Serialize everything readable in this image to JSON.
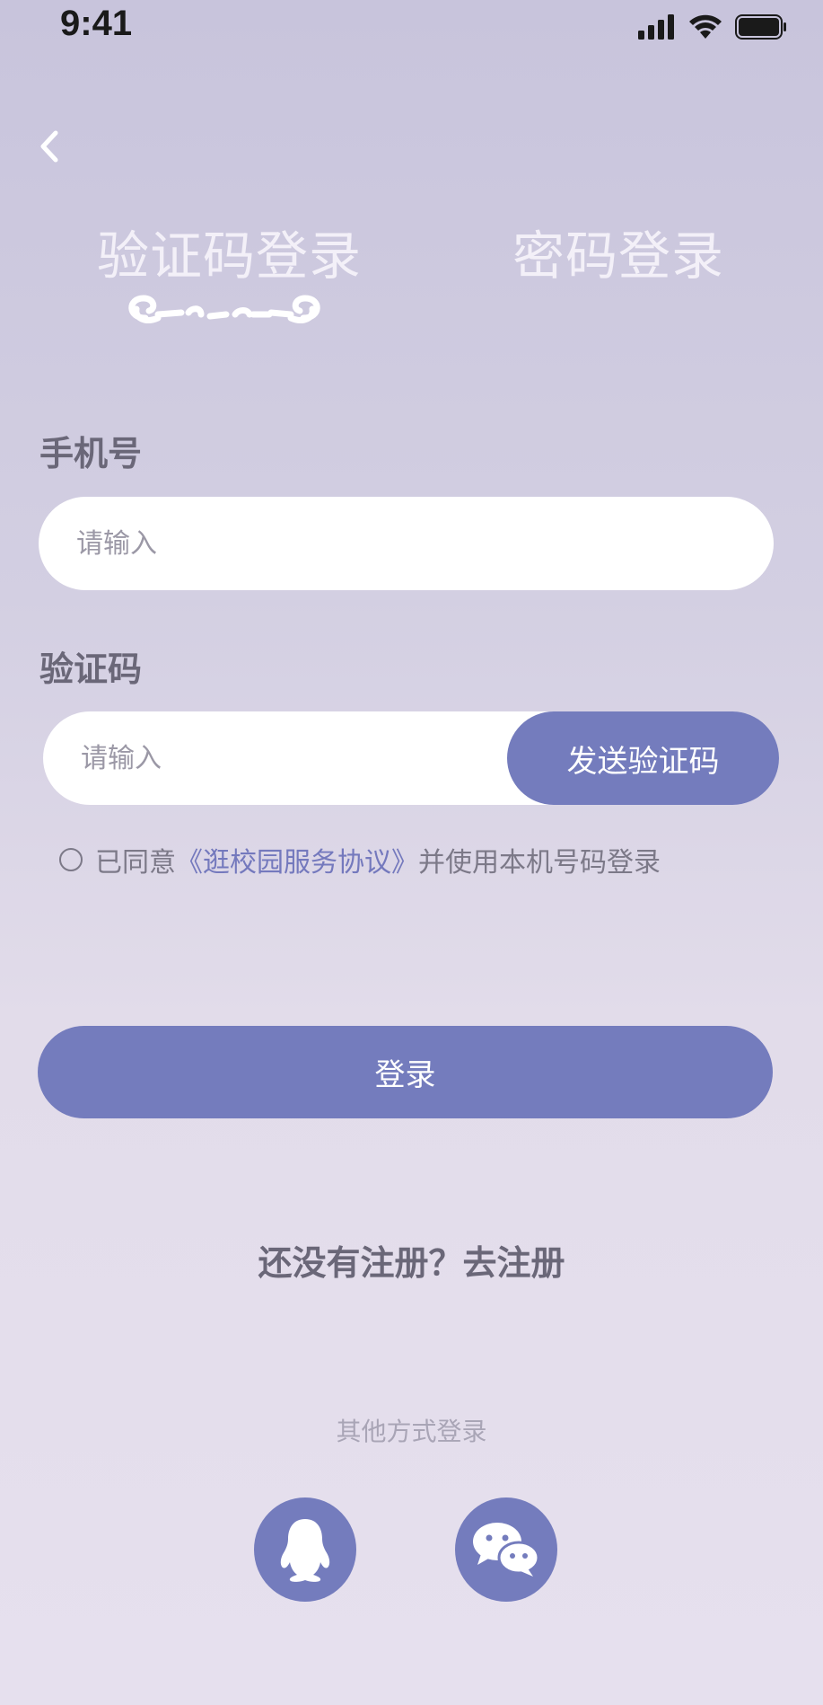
{
  "status_bar": {
    "time": "9:41"
  },
  "tabs": [
    {
      "label": "验证码登录",
      "active": true
    },
    {
      "label": "密码登录",
      "active": false
    }
  ],
  "form": {
    "phone_label": "手机号",
    "phone_placeholder": "请输入",
    "code_label": "验证码",
    "code_placeholder": "请输入",
    "send_code_label": "发送验证码"
  },
  "agreement": {
    "prefix": "已同意",
    "link": "《逛校园服务协议》",
    "suffix": "并使用本机号码登录",
    "checked": false
  },
  "login_label": "登录",
  "register_text": "还没有注册？去注册",
  "other_login_label": "其他方式登录",
  "social_icons": [
    "qq-icon",
    "wechat-icon"
  ],
  "colors": {
    "accent": "#747cbd",
    "link": "#7479bd",
    "background": "#d3cfe2"
  }
}
